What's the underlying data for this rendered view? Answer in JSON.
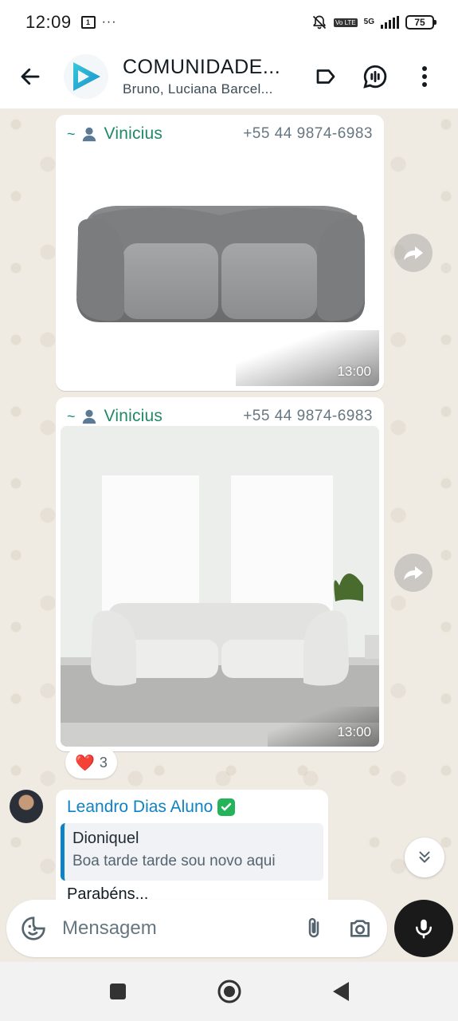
{
  "status_bar": {
    "time": "12:09",
    "notification_badge": "1",
    "more_dots": "···",
    "volte": "Vo LTE",
    "network": "5G",
    "battery": "75"
  },
  "header": {
    "title": "COMUNIDADE...",
    "subtitle": "Bruno, Luciana Barcel..."
  },
  "messages": [
    {
      "tilde": "~",
      "sender": "Vinicius",
      "phone": "+55 44 9874-6983",
      "time": "13:00",
      "media": "sofa-image"
    },
    {
      "tilde": "~",
      "sender": "Vinicius",
      "phone": "+55 44 9874-6983",
      "time": "13:00",
      "media": "room-sofa-image",
      "reaction": {
        "emoji": "❤️",
        "count": "3"
      }
    },
    {
      "sender": "Leandro Dias Aluno",
      "quote_author": "Dioniquel",
      "quote_text": "Boa tarde  tarde sou novo aqui",
      "text_partial": "Parabéns..."
    }
  ],
  "composer": {
    "placeholder": "Mensagem"
  },
  "colors": {
    "chat_bg": "#efeae2",
    "sender_green": "#1f8a64",
    "sender_blue": "#0f82c4",
    "mic_bg": "#1a1a1a"
  },
  "icons": [
    "back-arrow-icon",
    "label-icon",
    "voice-chat-icon",
    "more-vert-icon",
    "forward-icon",
    "scroll-down-icon",
    "sticker-icon",
    "attach-icon",
    "camera-icon",
    "mic-icon",
    "nav-recent-icon",
    "nav-home-icon",
    "nav-back-icon"
  ]
}
